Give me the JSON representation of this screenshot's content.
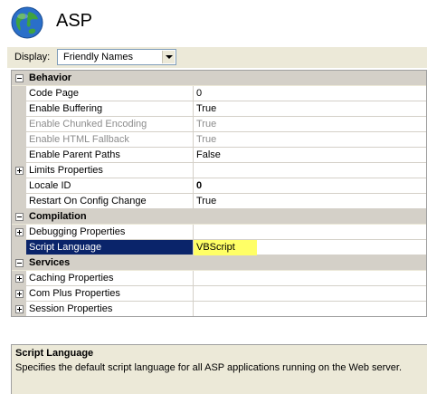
{
  "header": {
    "title": "ASP",
    "icon": "globe-icon"
  },
  "toolbar": {
    "display_label": "Display:",
    "display_value": "Friendly Names"
  },
  "grid": {
    "rows": [
      {
        "type": "category",
        "name": "Behavior",
        "expanded": true
      },
      {
        "type": "property",
        "name": "Code Page",
        "value": "0"
      },
      {
        "type": "property",
        "name": "Enable Buffering",
        "value": "True"
      },
      {
        "type": "property",
        "name": "Enable Chunked Encoding",
        "value": "True",
        "disabled": true
      },
      {
        "type": "property",
        "name": "Enable HTML Fallback",
        "value": "True",
        "disabled": true
      },
      {
        "type": "property",
        "name": "Enable Parent Paths",
        "value": "False"
      },
      {
        "type": "property",
        "name": "Limits Properties",
        "value": "",
        "expandable": true
      },
      {
        "type": "property",
        "name": "Locale ID",
        "value": "0",
        "bold_value": true
      },
      {
        "type": "property",
        "name": "Restart On Config Change",
        "value": "True"
      },
      {
        "type": "category",
        "name": "Compilation",
        "expanded": true
      },
      {
        "type": "property",
        "name": "Debugging Properties",
        "value": "",
        "expandable": true
      },
      {
        "type": "property",
        "name": "Script Language",
        "value": "VBScript",
        "selected": true
      },
      {
        "type": "category",
        "name": "Services",
        "expanded": true
      },
      {
        "type": "property",
        "name": "Caching Properties",
        "value": "",
        "expandable": true
      },
      {
        "type": "property",
        "name": "Com Plus Properties",
        "value": "",
        "expandable": true
      },
      {
        "type": "property",
        "name": "Session Properties",
        "value": "",
        "expandable": true
      }
    ]
  },
  "description": {
    "title": "Script Language",
    "text": "Specifies the default script language for all ASP applications running on the Web server."
  },
  "colors": {
    "selection": "#0a246a",
    "highlight": "#ffff66",
    "category_bg": "#d4d0c8"
  }
}
